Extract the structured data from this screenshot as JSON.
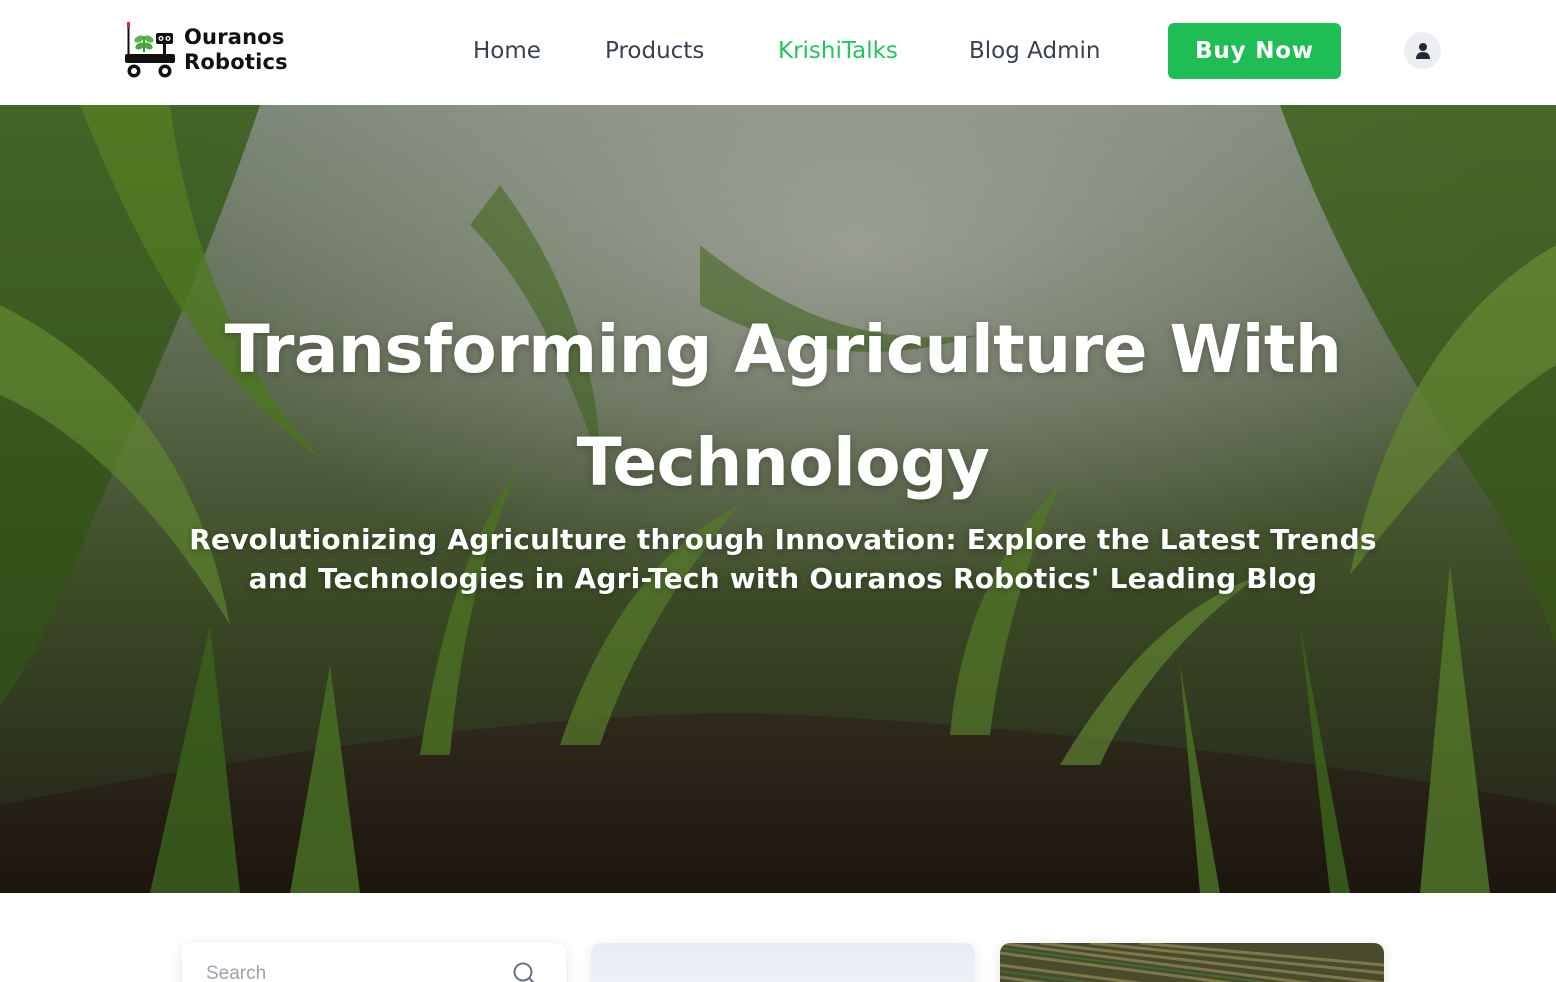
{
  "brand": {
    "line1": "Ouranos",
    "line2": "Robotics",
    "logo_icon": "robot-cart-icon"
  },
  "nav": {
    "items": [
      {
        "label": "Home",
        "active": false
      },
      {
        "label": "Products",
        "active": false
      },
      {
        "label": "KrishiTalks",
        "active": true
      },
      {
        "label": "Blog Admin",
        "active": false
      }
    ],
    "buy_label": "Buy Now",
    "account_icon": "user-icon"
  },
  "hero": {
    "title_line1": "Transforming Agriculture With",
    "title_line2": "Technology",
    "subtitle_line1": "Revolutionizing Agriculture through Innovation: Explore the Latest Trends",
    "subtitle_line2": "and Technologies in Agri-Tech with Ouranos Robotics' Leading Blog",
    "background": "corn-field-photo"
  },
  "search": {
    "placeholder": "Search",
    "icon": "search-icon"
  },
  "colors": {
    "accent": "#22c55e",
    "button": "#1fbe55",
    "nav_text": "#374151"
  }
}
